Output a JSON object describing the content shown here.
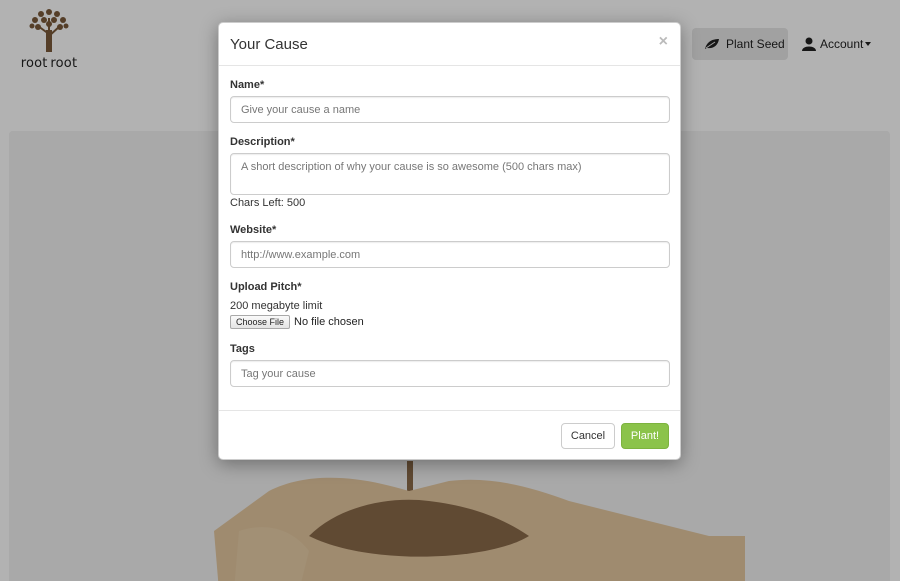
{
  "header": {
    "logo_text": "root root",
    "plant_seed_label": "Plant Seed",
    "account_label": "Account"
  },
  "modal": {
    "title": "Your Cause",
    "close_symbol": "×",
    "name": {
      "label": "Name*",
      "placeholder": "Give your cause a name",
      "value": ""
    },
    "description": {
      "label": "Description*",
      "placeholder": "A short description of why your cause is so awesome (500 chars max)",
      "value": "",
      "chars_left": "Chars Left: 500"
    },
    "website": {
      "label": "Website*",
      "placeholder": "http://www.example.com",
      "value": ""
    },
    "upload": {
      "label": "Upload Pitch*",
      "help": "200 megabyte limit",
      "button_label": "Choose File",
      "status": "No file chosen"
    },
    "tags": {
      "label": "Tags",
      "placeholder": "Tag your cause",
      "value": ""
    },
    "cancel_label": "Cancel",
    "submit_label": "Plant!"
  },
  "icons": {
    "leaf": "leaf-icon",
    "user": "user-icon",
    "close": "close-icon",
    "logo": "tree-logo"
  },
  "colors": {
    "accent_green": "#8bc34a",
    "backdrop": "rgba(0,0,0,0.30)",
    "logo_brown": "#7a5a3a"
  }
}
